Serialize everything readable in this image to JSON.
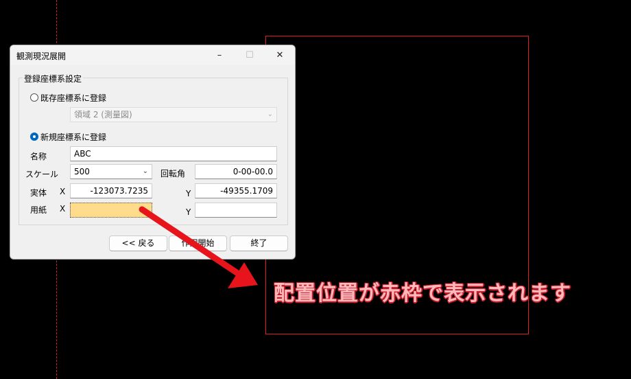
{
  "background": {
    "callout_text": "配置位置が赤枠で表示されます",
    "frame_color": "#e02020"
  },
  "dialog": {
    "title": "観測現況展開",
    "window_controls": {
      "minimize": "–",
      "maximize": "☐",
      "close": "✕"
    },
    "group_title": "登録座標系設定",
    "existing": {
      "label": "既存座標系に登録",
      "checked": false,
      "select_value": "領域 2 (測量図)"
    },
    "new": {
      "label": "新規座標系に登録",
      "checked": true
    },
    "name": {
      "label": "名称",
      "value": "ABC"
    },
    "scale": {
      "label": "スケール",
      "value": "500"
    },
    "rotation": {
      "label": "回転角",
      "value": "0-00-00.0"
    },
    "entity": {
      "label": "実体",
      "x_label": "X",
      "x_value": "-123073.7235",
      "y_label": "Y",
      "y_value": "-49355.1709"
    },
    "paper": {
      "label": "用紙",
      "x_label": "X",
      "x_value": "",
      "y_label": "Y",
      "y_value": ""
    },
    "buttons": {
      "back": "<< 戻る",
      "start": "作図開始",
      "finish": "終了"
    }
  },
  "colors": {
    "arrow": "#e8141c",
    "active_field": "#ffdc8c",
    "radio_accent": "#0067c0"
  }
}
